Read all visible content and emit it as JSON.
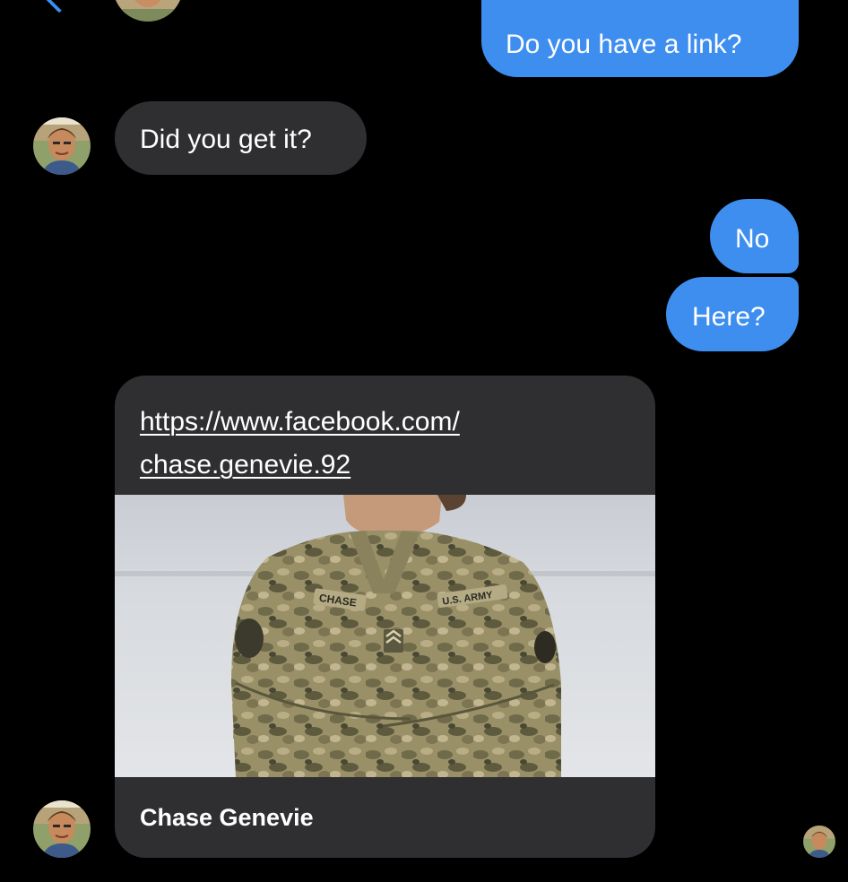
{
  "messages": [
    {
      "sender": "me",
      "text": "Do you have a link?"
    },
    {
      "sender": "contact",
      "text": "Did you get it?"
    },
    {
      "sender": "me",
      "text": "No"
    },
    {
      "sender": "me",
      "text": "Here?"
    }
  ],
  "link_card": {
    "url_line1": "https://www.facebook.com/",
    "url_line2": "chase.genevie.92",
    "title": "Chase Genevie",
    "image_description": "soldier in camouflage uniform with arms crossed",
    "uniform_name_tape": "CHASE",
    "uniform_branch_tape": "U.S. ARMY"
  },
  "colors": {
    "background": "#000000",
    "sent_bubble": "#3e8ef0",
    "received_bubble": "#2f2f31",
    "text": "#ffffff",
    "back_chevron": "#3a8ff0"
  },
  "icons": {
    "back": "chevron-left-icon",
    "contact_avatar": "profile-photo",
    "read_receipt": "read-receipt-avatar"
  }
}
